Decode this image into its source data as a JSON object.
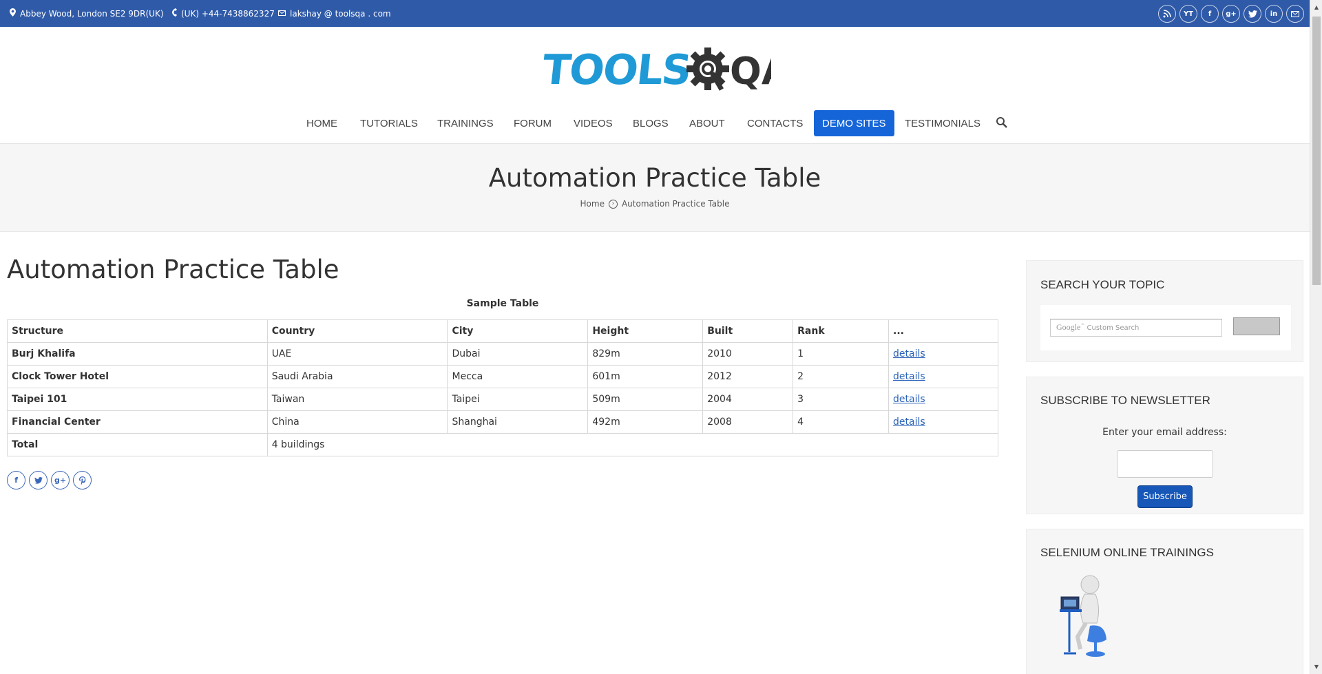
{
  "topbar": {
    "address": "Abbey Wood, London SE2 9DR(UK)",
    "phone": "(UK) +44-7438862327",
    "email": "lakshay @ toolsqa . com",
    "social": [
      "rss",
      "YT",
      "f",
      "g+",
      "twitter",
      "in",
      "mail"
    ]
  },
  "logo": {
    "text_tools": "TOOLS",
    "text_qa": "QA"
  },
  "nav": {
    "items": [
      "HOME",
      "TUTORIALS",
      "TRAININGS",
      "FORUM",
      "VIDEOS",
      "BLOGS",
      "ABOUT",
      "CONTACTS",
      "DEMO SITES",
      "TESTIMONIALS"
    ],
    "active": "DEMO SITES"
  },
  "page_header": {
    "title": "Automation Practice Table",
    "breadcrumb_home": "Home",
    "breadcrumb_current": "Automation Practice Table"
  },
  "main": {
    "title": "Automation Practice Table",
    "table_caption": "Sample Table",
    "columns": [
      "Structure",
      "Country",
      "City",
      "Height",
      "Built",
      "Rank",
      "..."
    ],
    "rows": [
      [
        "Burj Khalifa",
        "UAE",
        "Dubai",
        "829m",
        "2010",
        "1",
        "details"
      ],
      [
        "Clock Tower Hotel",
        "Saudi Arabia",
        "Mecca",
        "601m",
        "2012",
        "2",
        "details"
      ],
      [
        "Taipei 101",
        "Taiwan",
        "Taipei",
        "509m",
        "2004",
        "3",
        "details"
      ],
      [
        "Financial Center",
        "China",
        "Shanghai",
        "492m",
        "2008",
        "4",
        "details"
      ]
    ],
    "footer": {
      "label": "Total",
      "value": "4 buildings"
    },
    "share": [
      "f",
      "twitter",
      "g+",
      "pinterest"
    ]
  },
  "sidebar": {
    "search_title": "SEARCH YOUR TOPIC",
    "search_placeholder": "Custom Search",
    "search_brand": "Google",
    "newsletter_title": "SUBSCRIBE TO NEWSLETTER",
    "newsletter_label": "Enter your email address:",
    "subscribe_label": "Subscribe",
    "trainings_title": "SELENIUM ONLINE TRAININGS"
  },
  "colors": {
    "topbar": "#2f5aa8",
    "accent": "#1565d8",
    "logo_blue": "#1f9ad6",
    "link": "#2a62b9"
  }
}
